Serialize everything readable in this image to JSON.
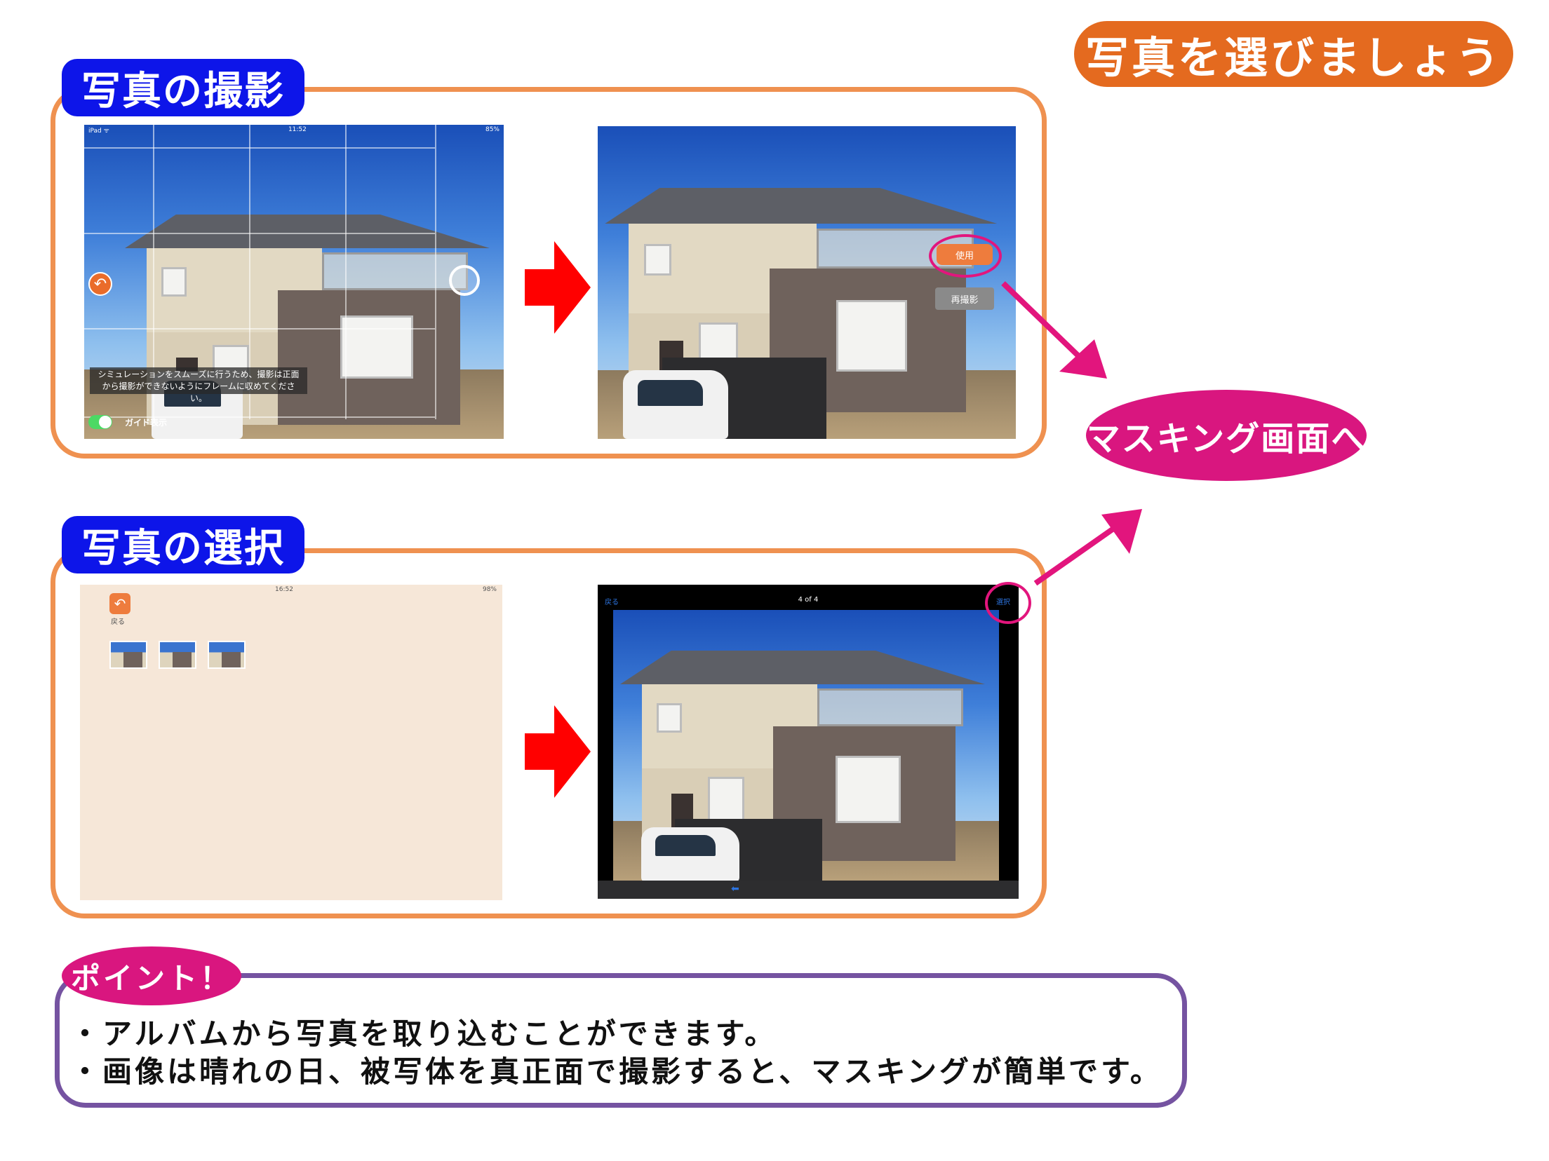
{
  "header": {
    "title": "写真を選びましょう"
  },
  "capture_section": {
    "label": "写真の撮影",
    "camera": {
      "status_left": "iPad ᯤ",
      "status_time": "11:52",
      "status_battery": "85%",
      "guide_message": "シミュレーションをスムーズに行うため、撮影は正面から撮影ができないようにフレームに収めてください。",
      "guide_toggle_label": "ガイド表示"
    },
    "confirm": {
      "use_button": "使用",
      "retake_button": "再撮影"
    }
  },
  "select_section": {
    "label": "写真の選択",
    "album": {
      "status_time": "16:52",
      "status_battery": "98%",
      "back_label": "戻る",
      "thumbnail_count": 3
    },
    "preview": {
      "nav_back": "戻る",
      "nav_counter": "4 of 4",
      "nav_select": "選択"
    }
  },
  "next_step": {
    "label": "マスキング画面へ"
  },
  "points": {
    "label": "ポイント！",
    "items": [
      "・アルバムから写真を取り込むことができます。",
      "・画像は晴れの日、被写体を真正面で撮影すると、マスキングが簡単です。"
    ]
  },
  "colors": {
    "title_orange": "#e46a1f",
    "section_border": "#ef9150",
    "section_label_blue": "#0d15e9",
    "accent_magenta": "#d9167f",
    "points_border": "#7553a1",
    "arrow_red": "#ff0000"
  }
}
